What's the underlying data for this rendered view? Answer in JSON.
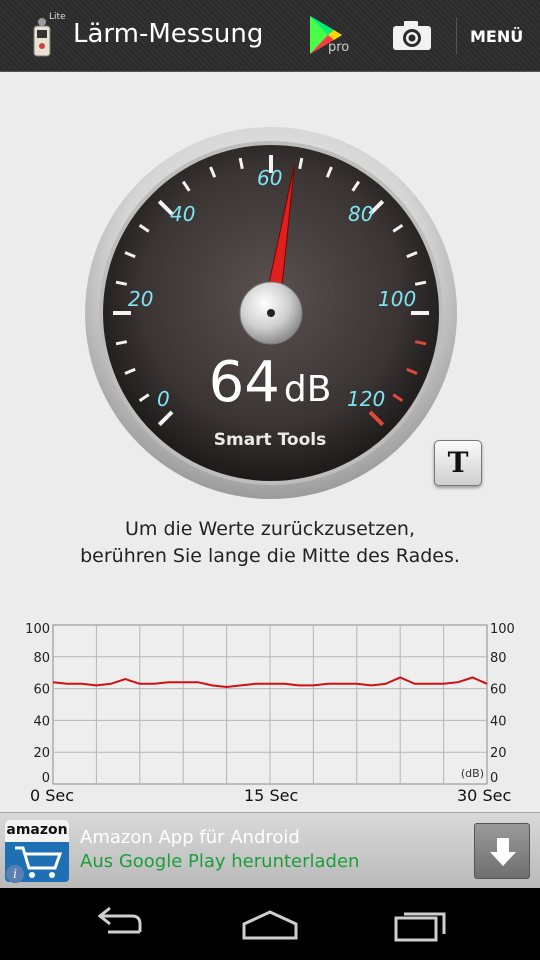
{
  "action_bar": {
    "app_badge": "Lite",
    "title": "Lärm-Messung",
    "pro_label": "pro",
    "menu_label": "MENÜ",
    "icons": [
      "sound-meter-app-icon",
      "google-play-icon",
      "camera-icon"
    ]
  },
  "gauge": {
    "current_value": "64",
    "unit": "dB",
    "needle_value": 64,
    "scale_min": 0,
    "scale_max": 120,
    "tick_labels": [
      "0",
      "20",
      "40",
      "60",
      "80",
      "100",
      "120"
    ],
    "brand": "Smart Tools",
    "colors": {
      "tick_label": "#7fe3f0",
      "needle": "#e0201c",
      "danger_ticks": "#e04a3a"
    }
  },
  "theme_button_label": "T",
  "hint": {
    "line1": "Um die Werte zurückzusetzen,",
    "line2": "berühren Sie lange die Mitte des Rades."
  },
  "history_graph": {
    "y_ticks": [
      "100",
      "80",
      "60",
      "40",
      "20",
      "0"
    ],
    "unit_label": "(dB)",
    "x_labels": {
      "start": "0 Sec",
      "mid": "15 Sec",
      "end": "30 Sec"
    }
  },
  "chart_data": {
    "type": "line",
    "x": [
      0,
      1,
      2,
      3,
      4,
      5,
      6,
      7,
      8,
      9,
      10,
      11,
      12,
      13,
      14,
      15,
      16,
      17,
      18,
      19,
      20,
      21,
      22,
      23,
      24,
      25,
      26,
      27,
      28,
      29,
      30
    ],
    "series": [
      {
        "values": [
          64,
          63,
          63,
          62,
          63,
          66,
          63,
          63,
          64,
          64,
          64,
          62,
          61,
          62,
          63,
          63,
          63,
          62,
          62,
          63,
          63,
          63,
          62,
          63,
          67,
          63,
          63,
          63,
          64,
          67,
          63
        ]
      }
    ],
    "xlabel_start": "0 Sec",
    "xlabel_mid": "15 Sec",
    "xlabel_end": "30 Sec",
    "ylim": [
      0,
      100
    ],
    "y_ticks": [
      0,
      20,
      40,
      60,
      80,
      100
    ],
    "grid": true,
    "line_color": "#d01010"
  },
  "ad": {
    "logo_text": "amazon",
    "title": "Amazon App für Android",
    "subtitle": "Aus Google Play herunterladen",
    "info_glyph": "i"
  },
  "nav": {
    "icons": [
      "back-icon",
      "home-icon",
      "recent-apps-icon"
    ]
  }
}
